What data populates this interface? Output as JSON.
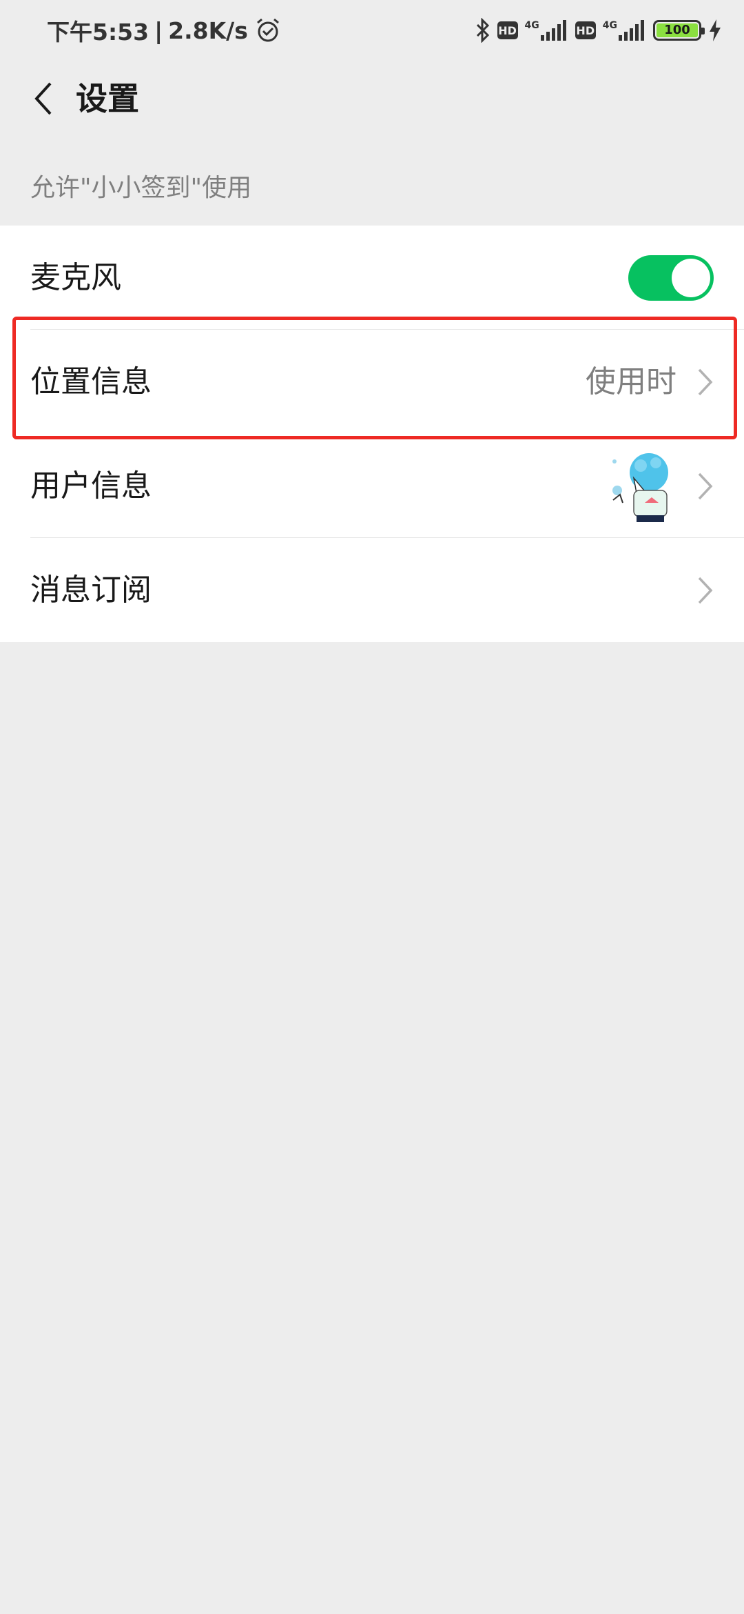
{
  "status_bar": {
    "time": "下午5:53",
    "separator": "|",
    "speed": "2.8K/s",
    "network_1": "4G",
    "network_2": "4G",
    "hd_1": "HD",
    "hd_2": "HD",
    "battery": "100",
    "icons": [
      "alarm-icon",
      "bluetooth-icon",
      "signal-icon",
      "charging-icon"
    ],
    "battery_color": "#8be040"
  },
  "nav": {
    "title": "设置",
    "back_icon": "chevron-left-icon"
  },
  "section": {
    "header": "允许\"小小签到\"使用"
  },
  "list": {
    "items": [
      {
        "label": "麦克风",
        "control": "toggle",
        "toggle_on": true
      },
      {
        "label": "位置信息",
        "value": "使用时",
        "control": "chevron"
      },
      {
        "label": "用户信息",
        "control": "avatar"
      },
      {
        "label": "消息订阅",
        "control": "chevron"
      }
    ]
  },
  "colors": {
    "accent": "#07c160",
    "background": "#ededed",
    "highlight": "#ee2a24"
  }
}
